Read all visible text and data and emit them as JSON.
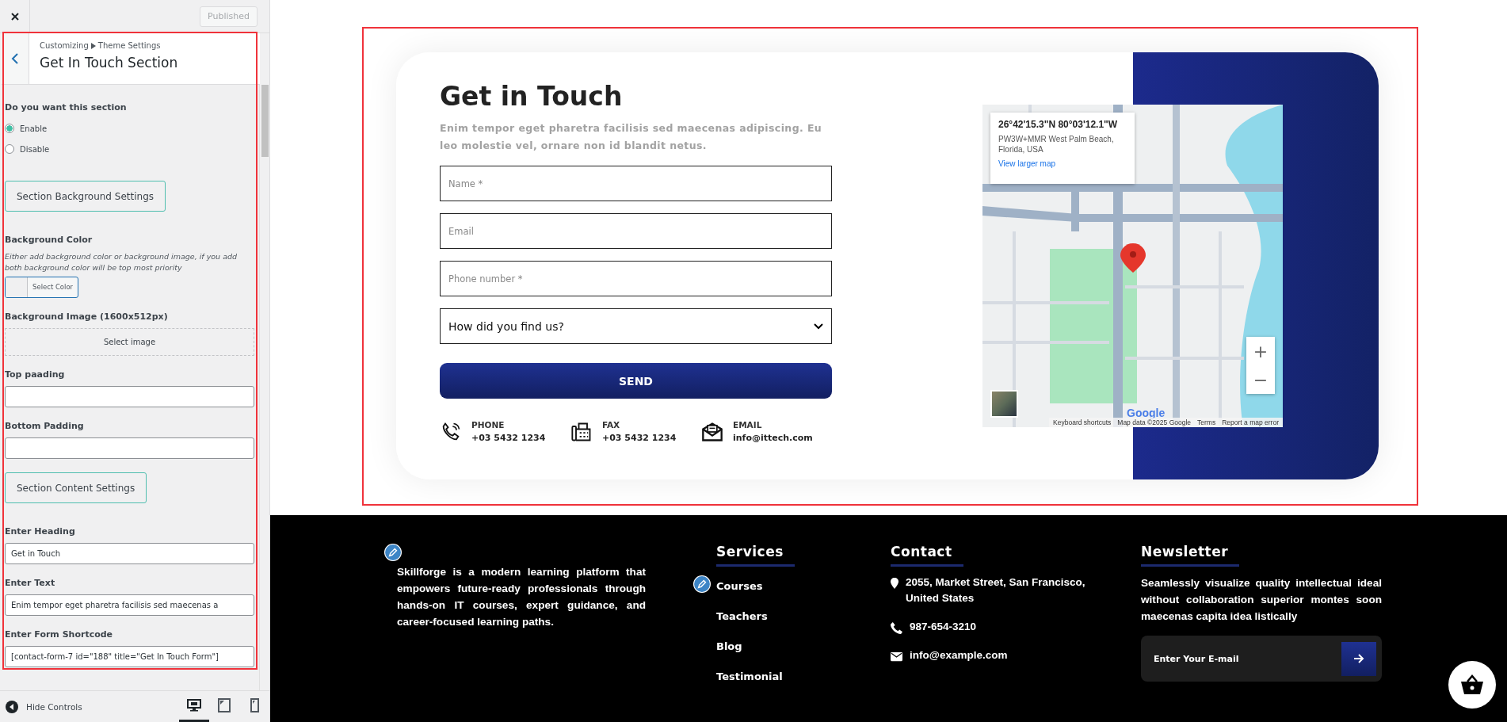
{
  "customizer": {
    "published_button": "Published",
    "breadcrumb": [
      "Customizing",
      "Theme Settings"
    ],
    "title": "Get In Touch Section",
    "controls": [
      {
        "kind": "radio",
        "label": "Do you want this section",
        "options": [
          {
            "label": "Enable",
            "selected": true
          },
          {
            "label": "Disable",
            "selected": false
          }
        ]
      },
      {
        "kind": "section_button",
        "label": "Section Background Settings"
      },
      {
        "kind": "color",
        "label": "Background Color",
        "description": "Either add background color or background image, if you add both background color will be top most priority",
        "button": "Select Color"
      },
      {
        "label": "Background Image (1600x512px)",
        "button": "Select image"
      },
      {
        "kind": "text",
        "label": "Top paading"
      },
      {
        "kind": "text",
        "label": "Bottom Padding"
      },
      {
        "kind": "section_button",
        "label": "Section Content Settings"
      },
      {
        "kind": "text",
        "label": "Enter Heading",
        "value": "Get in Touch"
      },
      {
        "kind": "text",
        "label": "Enter Text",
        "value": "Enim tempor eget pharetra facilisis sed maecenas a"
      },
      {
        "kind": "text",
        "label": "Enter Form Shortcode",
        "value": "[contact-form-7 id=\"188\" title=\"Get In Touch Form\"]"
      }
    ],
    "hide_controls": "Hide Controls",
    "devices": [
      {
        "kind": "desktop",
        "selected": true
      },
      {
        "kind": "tablet",
        "selected": false
      },
      {
        "kind": "mobile",
        "selected": false
      }
    ]
  },
  "contact_section": {
    "heading": "Get in Touch",
    "text": "Enim tempor eget pharetra facilisis sed maecenas adipiscing. Eu leo molestie vel, ornare non id blandit netus.",
    "fields": [
      {
        "kind": "input",
        "placeholder": "Name *"
      },
      {
        "kind": "input",
        "placeholder": "Email"
      },
      {
        "kind": "input",
        "placeholder": "Phone number *"
      },
      {
        "kind": "select",
        "value": "How did you find us?"
      }
    ],
    "submit": "SEND",
    "info": [
      {
        "kind": "phone",
        "label": "PHONE",
        "value": "+03 5432 1234"
      },
      {
        "kind": "fax",
        "label": "FAX",
        "value": "+03 5432 1234"
      },
      {
        "kind": "email",
        "label": "EMAIL",
        "value": "info@ittech.com"
      }
    ],
    "map": {
      "coordinates": "26°42'15.3\"N 80°03'12.1\"W",
      "address": "PW3W+MMR West Palm Beach, Florida, USA",
      "link": "View larger map",
      "zoom_in": "+",
      "zoom_out": "−",
      "logo": "Google",
      "attribution": [
        "Keyboard shortcuts",
        "Map data ©2025 Google",
        "Terms",
        "Report a map error"
      ]
    }
  },
  "footer": {
    "about": "Skillforge is a modern learning platform that empowers future-ready professionals through hands-on IT courses, expert guidance, and career-focused learning paths.",
    "services": {
      "title": "Services",
      "items": [
        "Courses",
        "Teachers",
        "Blog",
        "Testimonial"
      ]
    },
    "contact": {
      "title": "Contact",
      "items": [
        {
          "kind": "address",
          "text": "2055, Market Street, San Francisco, United States"
        },
        {
          "kind": "phone",
          "text": "987-654-3210"
        },
        {
          "kind": "email",
          "text": "info@example.com"
        }
      ]
    },
    "newsletter": {
      "title": "Newsletter",
      "text": "Seamlessly visualize quality intellectual ideal without collaboration superior montes soon maecenas capita idea listically",
      "placeholder": "Enter Your E-mail"
    }
  }
}
